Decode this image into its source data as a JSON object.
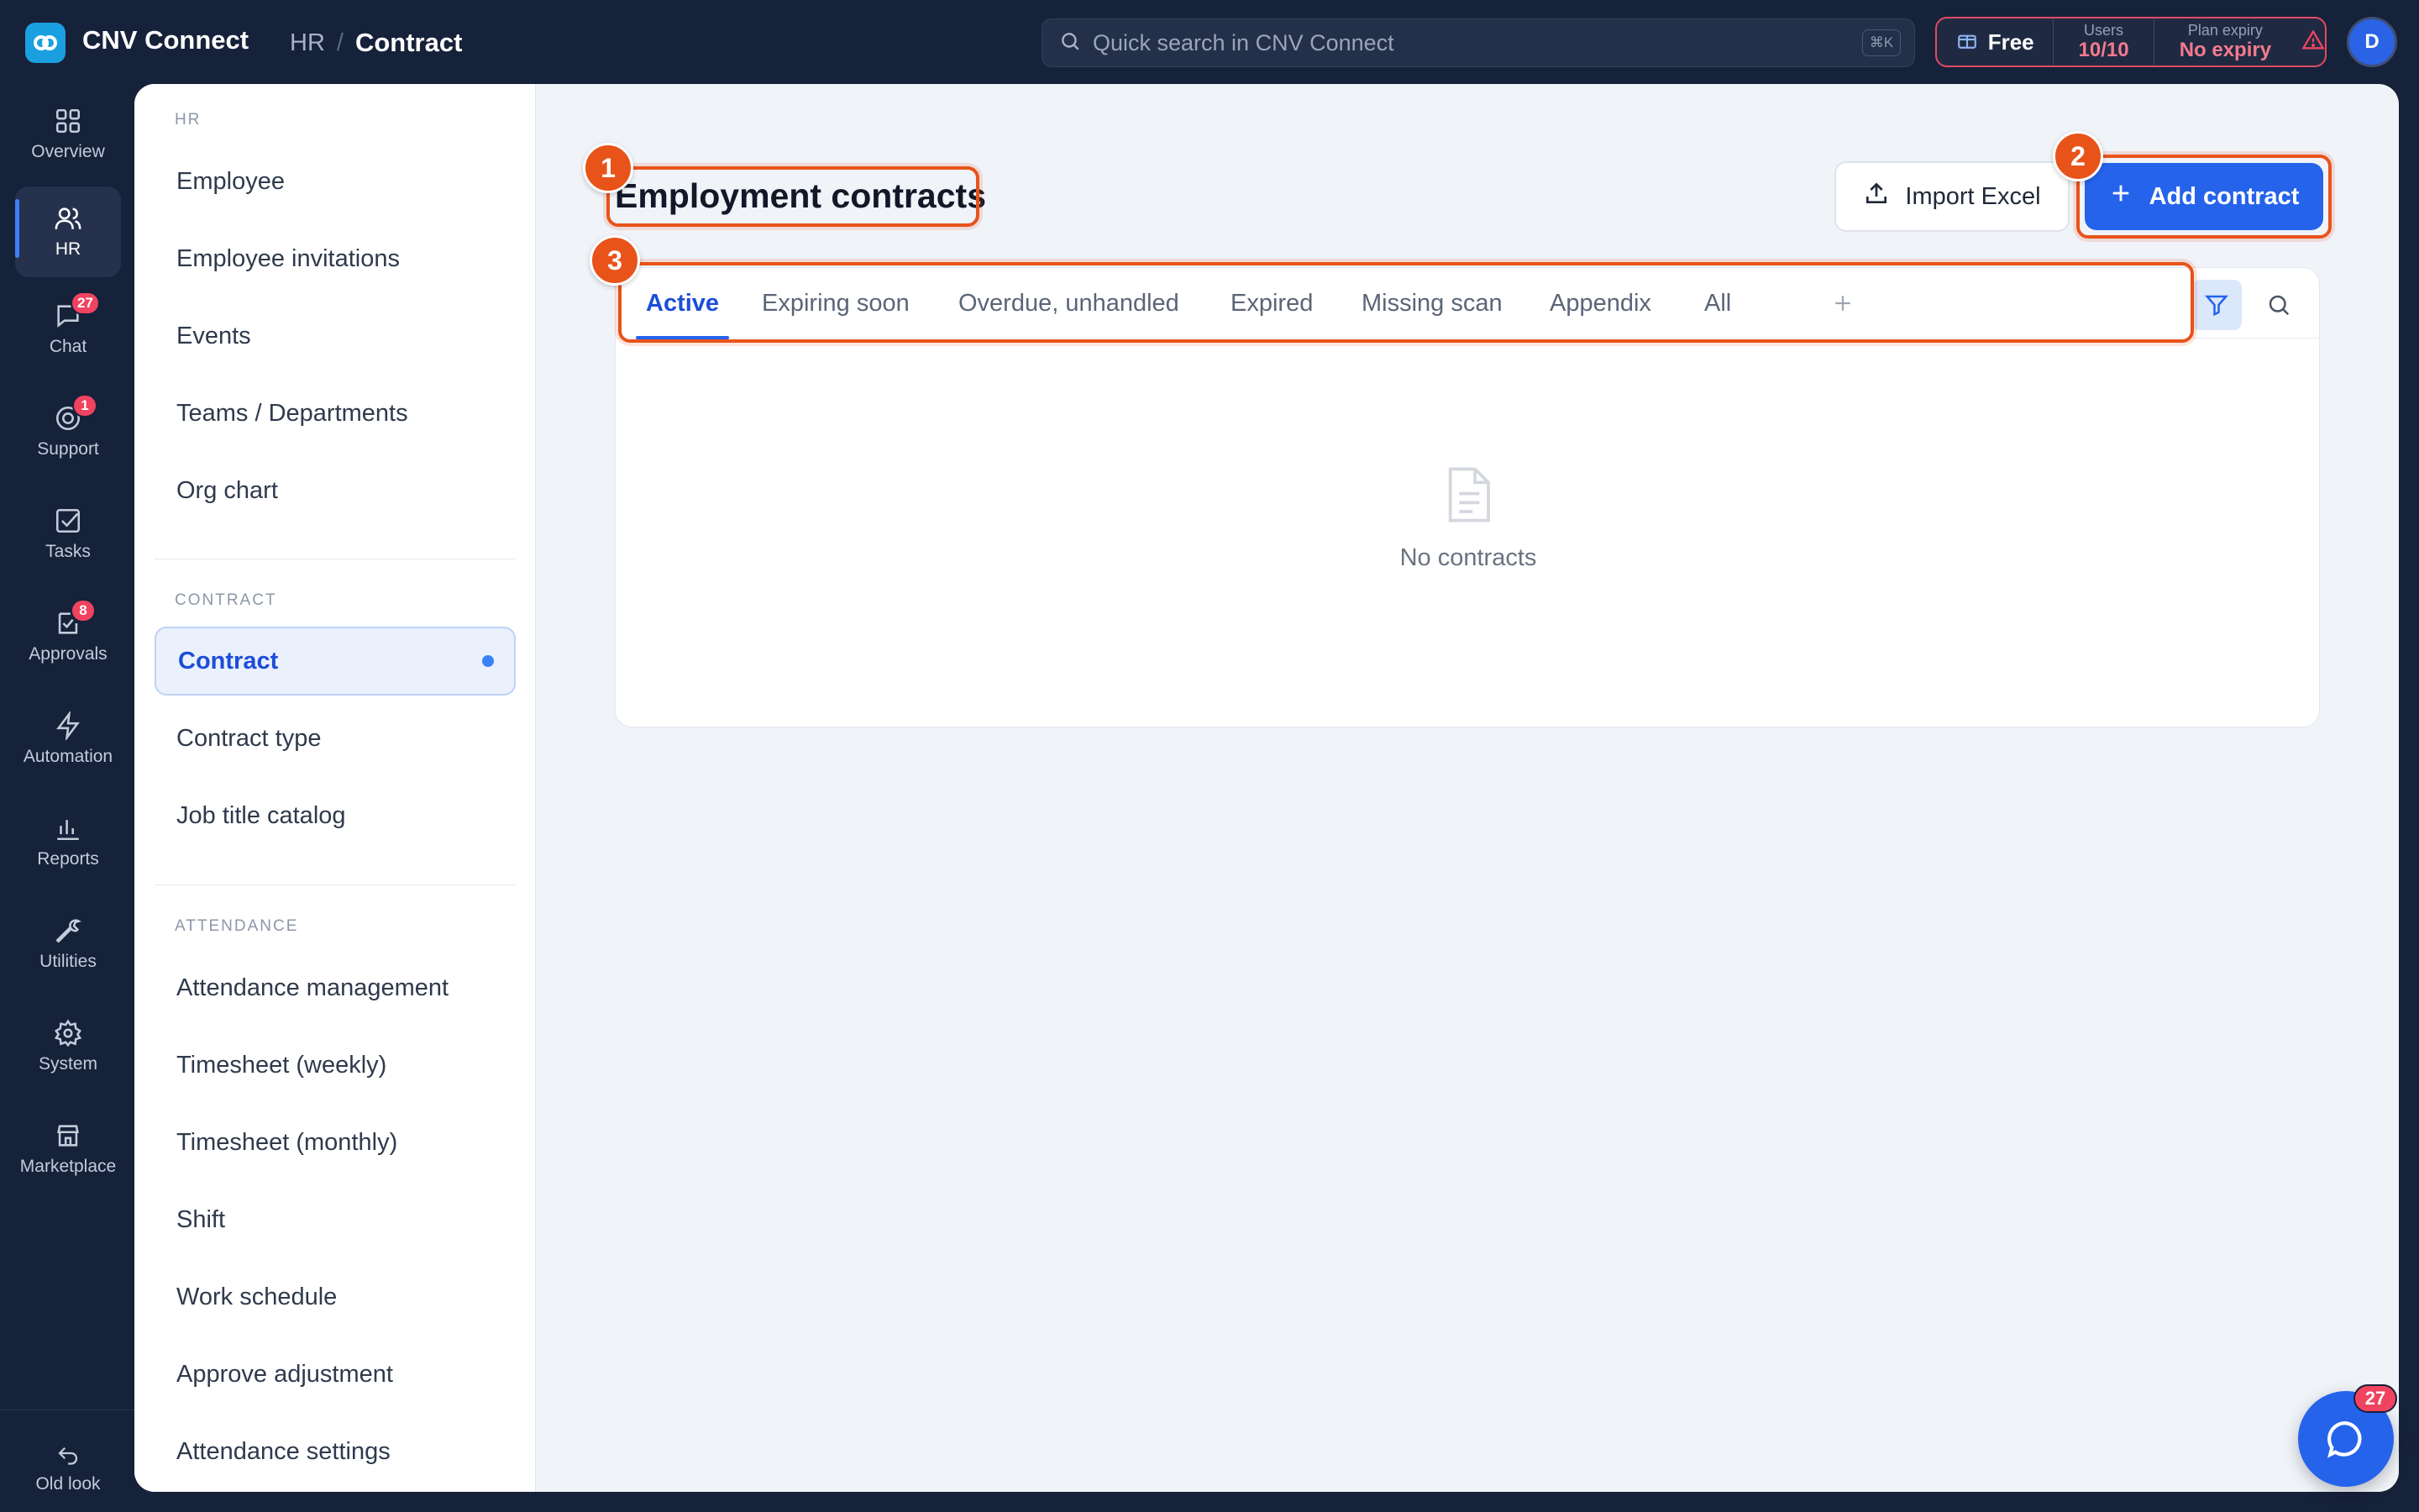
{
  "app": {
    "name": "CNV Connect"
  },
  "breadcrumb": {
    "root": "HR",
    "separator": "/",
    "current": "Contract"
  },
  "search": {
    "placeholder": "Quick search in CNV Connect",
    "shortcut": "⌘K"
  },
  "plan": {
    "name": "Free",
    "users_label": "Users",
    "users_value": "10/10",
    "expiry_label": "Plan expiry",
    "expiry_value": "No expiry"
  },
  "user": {
    "initial": "D"
  },
  "rail": {
    "items": [
      {
        "label": "Overview",
        "icon": "grid-icon"
      },
      {
        "label": "HR",
        "icon": "users-icon",
        "active": true
      },
      {
        "label": "Chat",
        "icon": "chat-icon",
        "badge": "27"
      },
      {
        "label": "Support",
        "icon": "lifebuoy-icon",
        "badge": "1"
      },
      {
        "label": "Tasks",
        "icon": "checkbox-icon"
      },
      {
        "label": "Approvals",
        "icon": "approval-icon",
        "badge": "8"
      },
      {
        "label": "Automation",
        "icon": "lightning-icon"
      },
      {
        "label": "Reports",
        "icon": "bar-chart-icon"
      },
      {
        "label": "Utilities",
        "icon": "wrench-icon"
      },
      {
        "label": "System",
        "icon": "gear-icon"
      },
      {
        "label": "Marketplace",
        "icon": "store-icon"
      }
    ],
    "footer": {
      "label": "Old look",
      "icon": "undo-icon"
    }
  },
  "subnav": {
    "hr_title": "HR",
    "hr_items": [
      "Employee",
      "Employee invitations",
      "Events",
      "Teams / Departments",
      "Org chart"
    ],
    "contract_title": "CONTRACT",
    "contract_items": [
      "Contract",
      "Contract type",
      "Job title catalog"
    ],
    "attendance_title": "ATTENDANCE",
    "attendance_items": [
      "Attendance management",
      "Timesheet (weekly)",
      "Timesheet (monthly)",
      "Shift",
      "Work schedule",
      "Approve adjustment",
      "Attendance settings"
    ]
  },
  "main": {
    "title": "Employment contracts",
    "import_label": "Import Excel",
    "add_label": "Add contract",
    "tabs": [
      "Active",
      "Expiring soon",
      "Overdue, unhandled",
      "Expired",
      "Missing scan",
      "Appendix",
      "All"
    ],
    "active_tab": "Active",
    "empty_text": "No contracts"
  },
  "annotations": {
    "marker_1": "1",
    "marker_2": "2",
    "marker_3": "3"
  },
  "chat_fab": {
    "badge": "27"
  },
  "colors": {
    "accent": "#2563eb",
    "highlight": "#e8531a",
    "alert": "#f0435f",
    "navy": "#16213a"
  }
}
